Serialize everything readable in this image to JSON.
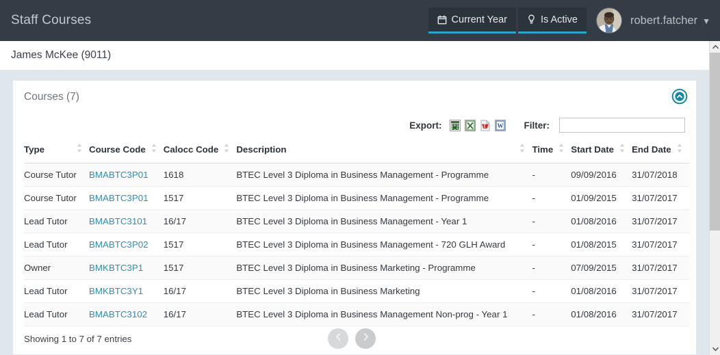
{
  "header": {
    "app_title": "Staff Courses",
    "toggles": [
      {
        "label": "Current Year",
        "icon": "calendar-icon"
      },
      {
        "label": "Is Active",
        "icon": "lightbulb-icon"
      }
    ],
    "username": "robert.fatcher",
    "caret": "▼",
    "accent_color": "#2ba6cb",
    "bar_color": "#343d46"
  },
  "subheader": {
    "breadcrumb": "James McKee (9011)"
  },
  "panel": {
    "title": "Courses (7)",
    "collapse_icon": "chevron-up-circle-icon",
    "collapse_color": "#1387a8"
  },
  "tools": {
    "export_label": "Export:",
    "export_buttons": [
      {
        "name": "export-csv",
        "icon": "csv-icon"
      },
      {
        "name": "export-excel",
        "icon": "excel-icon"
      },
      {
        "name": "export-pdf",
        "icon": "pdf-icon"
      },
      {
        "name": "export-word",
        "icon": "word-icon"
      }
    ],
    "filter_label": "Filter:",
    "filter_value": "",
    "filter_placeholder": ""
  },
  "table": {
    "columns": [
      {
        "key": "type",
        "label": "Type",
        "sortable": true
      },
      {
        "key": "course_code",
        "label": "Course Code",
        "sortable": true
      },
      {
        "key": "calocc_code",
        "label": "Calocc Code",
        "sortable": true
      },
      {
        "key": "description",
        "label": "Description",
        "sortable": true
      },
      {
        "key": "time",
        "label": "Time",
        "sortable": true
      },
      {
        "key": "start_date",
        "label": "Start Date",
        "sortable": true
      },
      {
        "key": "end_date",
        "label": "End Date",
        "sortable": true
      }
    ],
    "rows": [
      {
        "type": "Course Tutor",
        "course_code": "BMABTC3P01",
        "calocc_code": "1618",
        "description": "BTEC Level 3 Diploma in Business Management - Programme",
        "time": "-",
        "start_date": "09/09/2016",
        "end_date": "31/07/2018"
      },
      {
        "type": "Course Tutor",
        "course_code": "BMABTC3P01",
        "calocc_code": "1517",
        "description": "BTEC Level 3 Diploma in Business Management - Programme",
        "time": "-",
        "start_date": "01/09/2015",
        "end_date": "31/07/2017"
      },
      {
        "type": "Lead Tutor",
        "course_code": "BMABTC3101",
        "calocc_code": "16/17",
        "description": "BTEC Level 3 Diploma in Business Management - Year 1",
        "time": "-",
        "start_date": "01/08/2016",
        "end_date": "31/07/2017"
      },
      {
        "type": "Lead Tutor",
        "course_code": "BMABTC3P02",
        "calocc_code": "1517",
        "description": "BTEC Level 3 Diploma in Business Management - 720 GLH Award",
        "time": "-",
        "start_date": "01/08/2015",
        "end_date": "31/07/2017"
      },
      {
        "type": "Owner",
        "course_code": "BMKBTC3P1",
        "calocc_code": "1517",
        "description": "BTEC Level 3 Diploma in Business Marketing - Programme",
        "time": "-",
        "start_date": "07/09/2015",
        "end_date": "31/07/2017"
      },
      {
        "type": "Lead Tutor",
        "course_code": "BMKBTC3Y1",
        "calocc_code": "16/17",
        "description": "BTEC Level 3 Diploma in Business Marketing",
        "time": "-",
        "start_date": "01/08/2016",
        "end_date": "31/07/2017"
      },
      {
        "type": "Lead Tutor",
        "course_code": "BMABTC3102",
        "calocc_code": "16/17",
        "description": "BTEC Level 3 Diploma in Business Management Non-prog - Year 1",
        "time": "-",
        "start_date": "01/08/2016",
        "end_date": "31/07/2017"
      }
    ]
  },
  "footer": {
    "showing": "Showing 1 to 7 of 7 entries",
    "prev_icon": "chevron-left-icon",
    "next_icon": "chevron-right-icon"
  },
  "scrollbar": {
    "up_icon": "scroll-up-arrow-icon",
    "down_icon": "scroll-down-arrow-icon"
  }
}
